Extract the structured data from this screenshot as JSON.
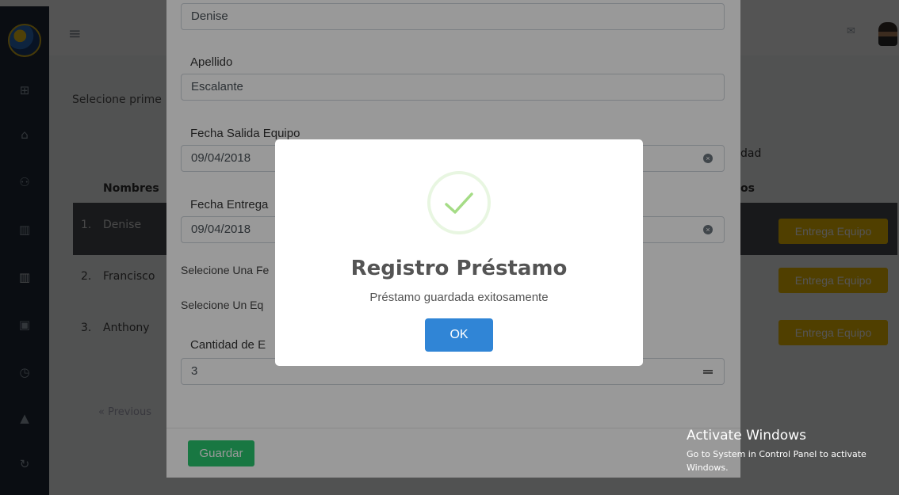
{
  "background": {
    "instruction": "Selecione prime",
    "columns": {
      "nombres": "Nombres",
      "cantidad_partial": "dad",
      "equipos_partial": "os"
    },
    "rows": [
      {
        "index": "1.",
        "name": "Denise",
        "action": "Entrega Equipo"
      },
      {
        "index": "2.",
        "name": "Francisco",
        "action": "Entrega Equipo"
      },
      {
        "index": "3.",
        "name": "Anthony",
        "action": "Entrega Equipo"
      }
    ],
    "prev_label": "« Previous"
  },
  "form": {
    "name_value": "Denise",
    "apellido_label": "Apellido",
    "apellido_value": "Escalante",
    "fecha_salida_label": "Fecha Salida Equipo",
    "fecha_salida_value": "09/04/2018",
    "fecha_entrega_label": "Fecha Entrega",
    "fecha_entrega_value": "09/04/2018",
    "select_fecha_text": "Selecione Una Fe",
    "select_equipo_text": "Selecione Un Eq",
    "cantidad_label": "Cantidad de E",
    "cantidad_value": "3",
    "save_label": "Guardar"
  },
  "alert": {
    "title": "Registro Préstamo",
    "message": "Préstamo guardada exitosamente",
    "ok_label": "OK"
  },
  "watermark": {
    "title": "Activate Windows",
    "line1": "Go to System in Control Panel to activate",
    "line2": "Windows."
  },
  "colors": {
    "sidebar": "#1f2a3a",
    "success": "#a5dc86",
    "ok_button": "#3085d6",
    "save_button": "#28c76f",
    "deliver_button": "#f5c000"
  }
}
